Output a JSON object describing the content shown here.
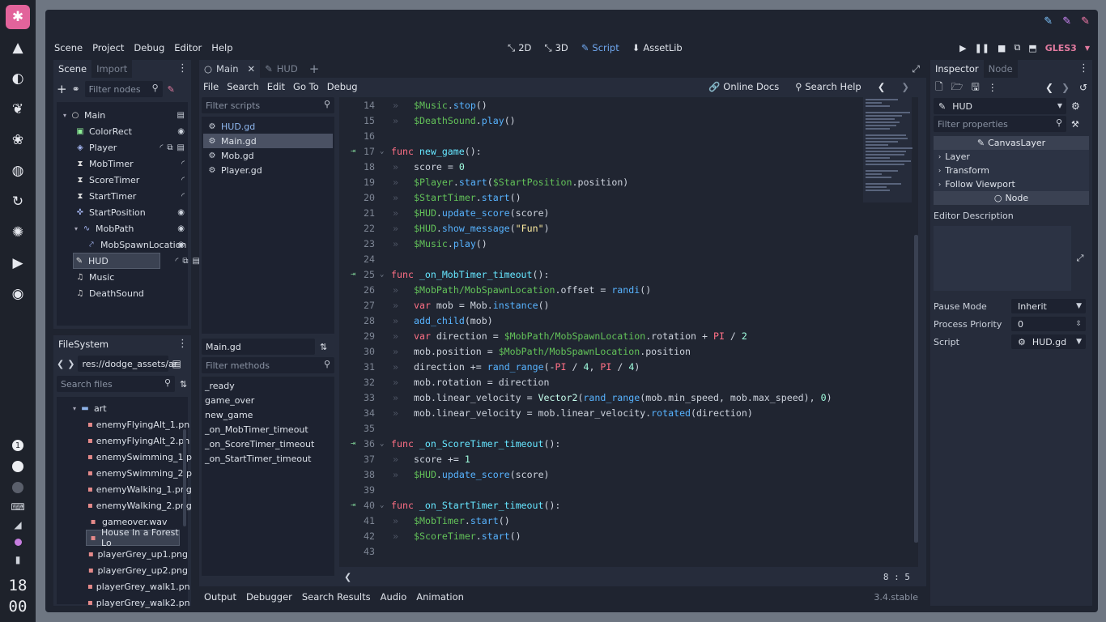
{
  "dock": {
    "app_icon": "godot-app-icon",
    "items": [
      "mountain-icon",
      "moon-icon",
      "leaf-icon",
      "lotus-icon",
      "palette-icon",
      "refresh-icon",
      "aperture-icon",
      "play-circle-icon",
      "audio-icon"
    ],
    "workspace_number": "1",
    "clock_hour": "18",
    "clock_minute": "00"
  },
  "menubar": {
    "menus": [
      "Scene",
      "Project",
      "Debug",
      "Editor",
      "Help"
    ],
    "workspaces": [
      {
        "label": "2D",
        "active": false
      },
      {
        "label": "3D",
        "active": false
      },
      {
        "label": "Script",
        "active": true
      },
      {
        "label": "AssetLib",
        "active": false
      }
    ],
    "renderer": "GLES3"
  },
  "scene_dock": {
    "tabs": [
      "Scene",
      "Import"
    ],
    "filter_placeholder": "Filter nodes",
    "nodes": [
      {
        "label": "Main",
        "depth": 0,
        "icon": "node-icon",
        "color": "#e0e0e0",
        "selected": false
      },
      {
        "label": "ColorRect",
        "depth": 1,
        "icon": "colorrect-icon",
        "color": "#8eef97",
        "selected": false
      },
      {
        "label": "Player",
        "depth": 1,
        "icon": "kinematic-icon",
        "color": "#a5b7f3",
        "selected": false
      },
      {
        "label": "MobTimer",
        "depth": 1,
        "icon": "timer-icon",
        "color": "#e0e0e0",
        "selected": false
      },
      {
        "label": "ScoreTimer",
        "depth": 1,
        "icon": "timer-icon",
        "color": "#e0e0e0",
        "selected": false
      },
      {
        "label": "StartTimer",
        "depth": 1,
        "icon": "timer-icon",
        "color": "#e0e0e0",
        "selected": false
      },
      {
        "label": "StartPosition",
        "depth": 1,
        "icon": "position-icon",
        "color": "#a5b7f3",
        "selected": false
      },
      {
        "label": "MobPath",
        "depth": 1,
        "icon": "path-icon",
        "color": "#a5b7f3",
        "selected": false
      },
      {
        "label": "MobSpawnLocation",
        "depth": 2,
        "icon": "pathfollow-icon",
        "color": "#a5b7f3",
        "selected": false
      },
      {
        "label": "HUD",
        "depth": 1,
        "icon": "canvaslayer-icon",
        "color": "#e0e0e0",
        "selected": true
      },
      {
        "label": "Music",
        "depth": 1,
        "icon": "audio-player-icon",
        "color": "#e0e0e0",
        "selected": false
      },
      {
        "label": "DeathSound",
        "depth": 1,
        "icon": "audio-player-icon",
        "color": "#e0e0e0",
        "selected": false
      }
    ]
  },
  "filesystem_dock": {
    "title": "FileSystem",
    "path": "res://dodge_assets/ar",
    "search_placeholder": "Search files",
    "items": [
      {
        "label": "art",
        "folder": true,
        "selected": false
      },
      {
        "label": "enemyFlyingAlt_1.pn",
        "folder": false,
        "selected": false
      },
      {
        "label": "enemyFlyingAlt_2.pn",
        "folder": false,
        "selected": false
      },
      {
        "label": "enemySwimming_1.p",
        "folder": false,
        "selected": false
      },
      {
        "label": "enemySwimming_2.p",
        "folder": false,
        "selected": false
      },
      {
        "label": "enemyWalking_1.png",
        "folder": false,
        "selected": false
      },
      {
        "label": "enemyWalking_2.png",
        "folder": false,
        "selected": false
      },
      {
        "label": "gameover.wav",
        "folder": false,
        "selected": false
      },
      {
        "label": "House In a Forest Lo",
        "folder": false,
        "selected": true
      },
      {
        "label": "playerGrey_up1.png",
        "folder": false,
        "selected": false
      },
      {
        "label": "playerGrey_up2.png",
        "folder": false,
        "selected": false
      },
      {
        "label": "playerGrey_walk1.pn",
        "folder": false,
        "selected": false
      },
      {
        "label": "playerGrey_walk2.pn",
        "folder": false,
        "selected": false
      }
    ]
  },
  "script_tabs": [
    {
      "label": "Main",
      "active": true
    },
    {
      "label": "HUD",
      "active": false
    }
  ],
  "script_menu": [
    "File",
    "Search",
    "Edit",
    "Go To",
    "Debug"
  ],
  "script_help": {
    "online_docs": "Online Docs",
    "search_help": "Search Help"
  },
  "script_list": {
    "filter_placeholder": "Filter scripts",
    "scripts": [
      {
        "label": "HUD.gd",
        "selected": false
      },
      {
        "label": "Main.gd",
        "selected": true
      },
      {
        "label": "Mob.gd",
        "selected": false
      },
      {
        "label": "Player.gd",
        "selected": false
      }
    ],
    "current": "Main.gd",
    "methods_placeholder": "Filter methods",
    "methods": [
      "_ready",
      "game_over",
      "new_game",
      "_on_MobTimer_timeout",
      "_on_ScoreTimer_timeout",
      "_on_StartTimer_timeout"
    ]
  },
  "code_lines": [
    {
      "n": 14,
      "indent": 1,
      "tokens": [
        [
          "node",
          "$Music"
        ],
        [
          "p",
          "."
        ],
        [
          "fnc",
          "stop"
        ],
        [
          "p",
          "()"
        ]
      ]
    },
    {
      "n": 15,
      "indent": 1,
      "tokens": [
        [
          "node",
          "$DeathSound"
        ],
        [
          "p",
          "."
        ],
        [
          "fnc",
          "play"
        ],
        [
          "p",
          "()"
        ]
      ]
    },
    {
      "n": 16,
      "indent": 0,
      "tokens": []
    },
    {
      "n": 17,
      "indent": 0,
      "mark": true,
      "fold": true,
      "tokens": [
        [
          "kw",
          "func "
        ],
        [
          "fn",
          "new_game"
        ],
        [
          "p",
          "():"
        ]
      ]
    },
    {
      "n": 18,
      "indent": 1,
      "tokens": [
        [
          "p",
          "score = "
        ],
        [
          "num",
          "0"
        ]
      ]
    },
    {
      "n": 19,
      "indent": 1,
      "tokens": [
        [
          "node",
          "$Player"
        ],
        [
          "p",
          "."
        ],
        [
          "fnc",
          "start"
        ],
        [
          "p",
          "("
        ],
        [
          "node",
          "$StartPosition"
        ],
        [
          "p",
          ".position)"
        ]
      ]
    },
    {
      "n": 20,
      "indent": 1,
      "tokens": [
        [
          "node",
          "$StartTimer"
        ],
        [
          "p",
          "."
        ],
        [
          "fnc",
          "start"
        ],
        [
          "p",
          "()"
        ]
      ]
    },
    {
      "n": 21,
      "indent": 1,
      "tokens": [
        [
          "node",
          "$HUD"
        ],
        [
          "p",
          "."
        ],
        [
          "fnc",
          "update_score"
        ],
        [
          "p",
          "(score)"
        ]
      ]
    },
    {
      "n": 22,
      "indent": 1,
      "tokens": [
        [
          "node",
          "$HUD"
        ],
        [
          "p",
          "."
        ],
        [
          "fnc",
          "show_message"
        ],
        [
          "p",
          "("
        ],
        [
          "str",
          "\"Fun\""
        ],
        [
          "p",
          ")"
        ]
      ]
    },
    {
      "n": 23,
      "indent": 1,
      "tokens": [
        [
          "node",
          "$Music"
        ],
        [
          "p",
          "."
        ],
        [
          "fnc",
          "play"
        ],
        [
          "p",
          "()"
        ]
      ]
    },
    {
      "n": 24,
      "indent": 0,
      "tokens": []
    },
    {
      "n": 25,
      "indent": 0,
      "mark": true,
      "fold": true,
      "tokens": [
        [
          "kw",
          "func "
        ],
        [
          "fn",
          "_on_MobTimer_timeout"
        ],
        [
          "p",
          "():"
        ]
      ]
    },
    {
      "n": 26,
      "indent": 1,
      "tokens": [
        [
          "node",
          "$MobPath/MobSpawnLocation"
        ],
        [
          "p",
          ".offset = "
        ],
        [
          "fnc",
          "randi"
        ],
        [
          "p",
          "()"
        ]
      ]
    },
    {
      "n": 27,
      "indent": 1,
      "tokens": [
        [
          "kw",
          "var "
        ],
        [
          "p",
          "mob = Mob."
        ],
        [
          "fnc",
          "instance"
        ],
        [
          "p",
          "()"
        ]
      ]
    },
    {
      "n": 28,
      "indent": 1,
      "tokens": [
        [
          "fnc",
          "add_child"
        ],
        [
          "p",
          "(mob)"
        ]
      ]
    },
    {
      "n": 29,
      "indent": 1,
      "tokens": [
        [
          "kw",
          "var "
        ],
        [
          "p",
          "direction = "
        ],
        [
          "node",
          "$MobPath/MobSpawnLocation"
        ],
        [
          "p",
          ".rotation + "
        ],
        [
          "kw",
          "PI"
        ],
        [
          "p",
          " / "
        ],
        [
          "num",
          "2"
        ]
      ]
    },
    {
      "n": 30,
      "indent": 1,
      "tokens": [
        [
          "p",
          "mob.position = "
        ],
        [
          "node",
          "$MobPath/MobSpawnLocation"
        ],
        [
          "p",
          ".position"
        ]
      ]
    },
    {
      "n": 31,
      "indent": 1,
      "tokens": [
        [
          "p",
          "direction += "
        ],
        [
          "fnc",
          "rand_range"
        ],
        [
          "p",
          "(-"
        ],
        [
          "kw",
          "PI"
        ],
        [
          "p",
          " / "
        ],
        [
          "num",
          "4"
        ],
        [
          "p",
          ", "
        ],
        [
          "kw",
          "PI"
        ],
        [
          "p",
          " / "
        ],
        [
          "num",
          "4"
        ],
        [
          "p",
          ")"
        ]
      ]
    },
    {
      "n": 32,
      "indent": 1,
      "tokens": [
        [
          "p",
          "mob.rotation = direction"
        ]
      ]
    },
    {
      "n": 33,
      "indent": 1,
      "tokens": [
        [
          "p",
          "mob.linear_velocity = "
        ],
        [
          "cls",
          "Vector2"
        ],
        [
          "p",
          "("
        ],
        [
          "fnc",
          "rand_range"
        ],
        [
          "p",
          "(mob.min_speed, mob.max_speed), "
        ],
        [
          "num",
          "0"
        ],
        [
          "p",
          ")"
        ]
      ]
    },
    {
      "n": 34,
      "indent": 1,
      "tokens": [
        [
          "p",
          "mob.linear_velocity = mob.linear_velocity."
        ],
        [
          "fnc",
          "rotated"
        ],
        [
          "p",
          "(direction)"
        ]
      ]
    },
    {
      "n": 35,
      "indent": 0,
      "tokens": []
    },
    {
      "n": 36,
      "indent": 0,
      "mark": true,
      "fold": true,
      "tokens": [
        [
          "kw",
          "func "
        ],
        [
          "fn",
          "_on_ScoreTimer_timeout"
        ],
        [
          "p",
          "():"
        ]
      ]
    },
    {
      "n": 37,
      "indent": 1,
      "tokens": [
        [
          "p",
          "score += "
        ],
        [
          "num",
          "1"
        ]
      ]
    },
    {
      "n": 38,
      "indent": 1,
      "tokens": [
        [
          "node",
          "$HUD"
        ],
        [
          "p",
          "."
        ],
        [
          "fnc",
          "update_score"
        ],
        [
          "p",
          "(score)"
        ]
      ]
    },
    {
      "n": 39,
      "indent": 0,
      "tokens": []
    },
    {
      "n": 40,
      "indent": 0,
      "mark": true,
      "fold": true,
      "tokens": [
        [
          "kw",
          "func "
        ],
        [
          "fn",
          "_on_StartTimer_timeout"
        ],
        [
          "p",
          "():"
        ]
      ]
    },
    {
      "n": 41,
      "indent": 1,
      "tokens": [
        [
          "node",
          "$MobTimer"
        ],
        [
          "p",
          "."
        ],
        [
          "fnc",
          "start"
        ],
        [
          "p",
          "()"
        ]
      ]
    },
    {
      "n": 42,
      "indent": 1,
      "tokens": [
        [
          "node",
          "$ScoreTimer"
        ],
        [
          "p",
          "."
        ],
        [
          "fnc",
          "start"
        ],
        [
          "p",
          "()"
        ]
      ]
    },
    {
      "n": 43,
      "indent": 0,
      "tokens": []
    }
  ],
  "editor_status": {
    "line": "8",
    "sep": ":",
    "col": "5"
  },
  "bottom_tabs": [
    "Output",
    "Debugger",
    "Search Results",
    "Audio",
    "Animation"
  ],
  "version": "3.4.stable",
  "inspector": {
    "tabs": [
      "Inspector",
      "Node"
    ],
    "object": "HUD",
    "filter_placeholder": "Filter properties",
    "class_header": "CanvasLayer",
    "sections": [
      "Layer",
      "Transform",
      "Follow Viewport"
    ],
    "node_header": "Node",
    "editor_description": "Editor Description",
    "props": [
      {
        "label": "Pause Mode",
        "value": "Inherit",
        "kind": "dropdown"
      },
      {
        "label": "Process Priority",
        "value": "0",
        "kind": "spin"
      },
      {
        "label": "Script",
        "value": "HUD.gd",
        "kind": "resource"
      }
    ]
  }
}
